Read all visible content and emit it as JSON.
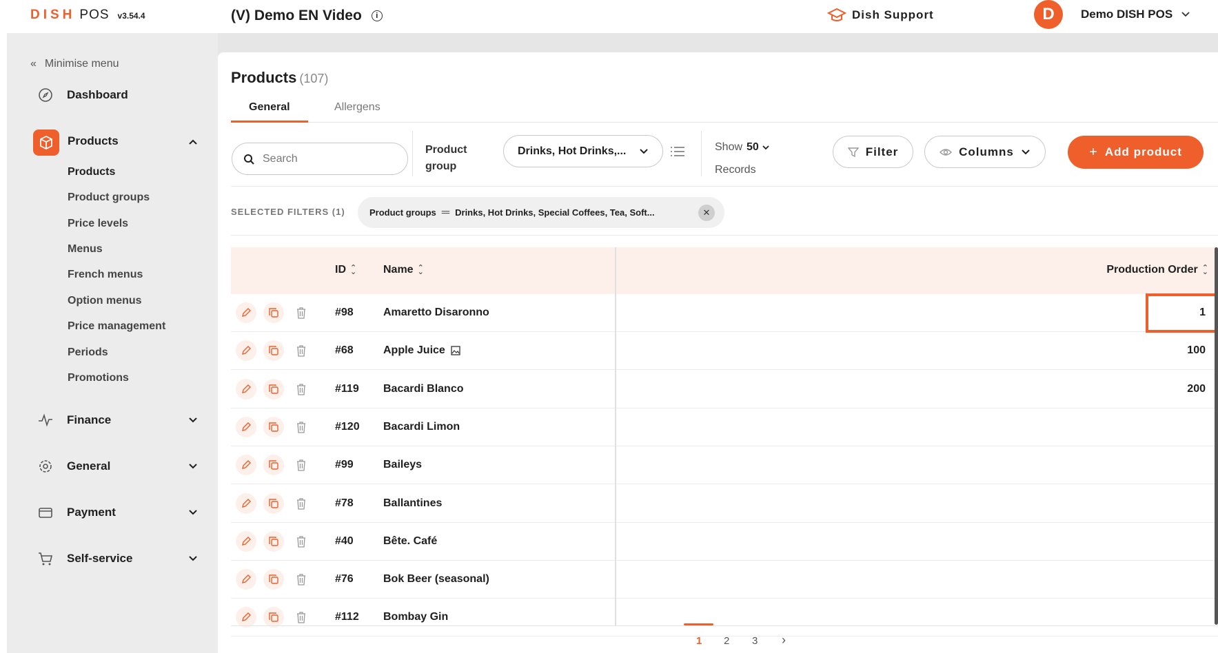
{
  "brand": {
    "dish": "DISH",
    "pos": "POS",
    "version": "v3.54.4"
  },
  "venue": {
    "name": "(V) Demo EN Video"
  },
  "support": {
    "label": "Dish Support"
  },
  "account": {
    "initial": "D",
    "name": "Demo DISH POS"
  },
  "sidebar": {
    "minimise_label": "Minimise menu",
    "dashboard": "Dashboard",
    "products": "Products",
    "sub_items": [
      "Products",
      "Product groups",
      "Price levels",
      "Menus",
      "French menus",
      "Option menus",
      "Price management",
      "Periods",
      "Promotions"
    ],
    "finance": "Finance",
    "general": "General",
    "payment": "Payment",
    "self_service": "Self-service"
  },
  "page": {
    "title": "Products",
    "count": "(107)"
  },
  "tabs": {
    "general": "General",
    "allergens": "Allergens"
  },
  "toolbar": {
    "search_placeholder": "Search",
    "product_group_label": "Product group",
    "product_group_value": "Drinks, Hot Drinks,...",
    "show_label": "Show",
    "show_value": "50",
    "records_label": "Records",
    "filter_label": "Filter",
    "columns_label": "Columns",
    "add_label": "Add product"
  },
  "filters": {
    "selected_label": "SELECTED FILTERS (1)",
    "chip_field": "Product groups",
    "chip_value": "Drinks, Hot Drinks, Special Coffees, Tea, Soft..."
  },
  "table": {
    "headers": {
      "id": "ID",
      "name": "Name",
      "production_order": "Production Order"
    },
    "rows": [
      {
        "id": "#98",
        "name": "Amaretto Disaronno",
        "order": "1",
        "image_icon": false
      },
      {
        "id": "#68",
        "name": "Apple Juice",
        "order": "100",
        "image_icon": true
      },
      {
        "id": "#119",
        "name": "Bacardi Blanco",
        "order": "200",
        "image_icon": false
      },
      {
        "id": "#120",
        "name": "Bacardi Limon",
        "order": "",
        "image_icon": false
      },
      {
        "id": "#99",
        "name": "Baileys",
        "order": "",
        "image_icon": false
      },
      {
        "id": "#78",
        "name": "Ballantines",
        "order": "",
        "image_icon": false
      },
      {
        "id": "#40",
        "name": "Bête. Café",
        "order": "",
        "image_icon": false
      },
      {
        "id": "#76",
        "name": "Bok Beer (seasonal)",
        "order": "",
        "image_icon": false
      },
      {
        "id": "#112",
        "name": "Bombay Gin",
        "order": "",
        "image_icon": false
      }
    ]
  },
  "pagination": {
    "pages": [
      "1",
      "2",
      "3"
    ],
    "current": "1",
    "next": "›"
  },
  "colors": {
    "accent": "#ee5f2b",
    "header_bg": "#fdf0ea",
    "sidebar_bg": "#ececec"
  }
}
